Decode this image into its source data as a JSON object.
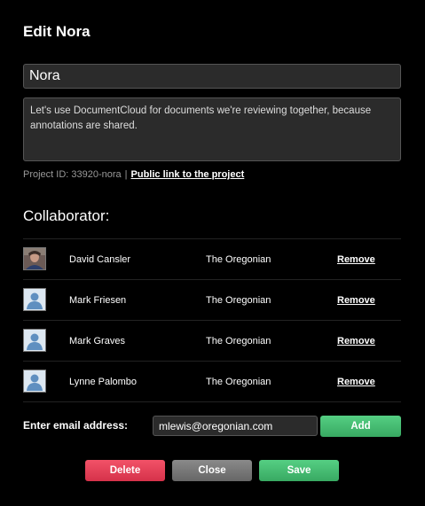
{
  "dialog": {
    "title": "Edit Nora",
    "project_name": "Nora",
    "description": "Let's use DocumentCloud for documents we're reviewing together, because annotations are shared.",
    "project_id_text": "Project ID: 33920-nora",
    "separator": "|",
    "public_link": "Public link to the project"
  },
  "collaborators": {
    "heading": "Collaborator:",
    "remove_label": "Remove",
    "items": [
      {
        "name": "David Cansler",
        "organization": "The Oregonian",
        "avatar": "photo-avatar"
      },
      {
        "name": "Mark Friesen",
        "organization": "The Oregonian",
        "avatar": "default-user-icon"
      },
      {
        "name": "Mark Graves",
        "organization": "The Oregonian",
        "avatar": "default-user-icon"
      },
      {
        "name": "Lynne Palombo",
        "organization": "The Oregonian",
        "avatar": "default-user-icon"
      }
    ]
  },
  "add_collaborator": {
    "label": "Enter email address:",
    "email_value": "mlewis@oregonian.com",
    "add_label": "Add"
  },
  "buttons": {
    "delete": "Delete",
    "close": "Close",
    "save": "Save"
  },
  "colors": {
    "background": "#000000",
    "green": "#3fb96b",
    "red": "#e43e56",
    "gray": "#777777"
  }
}
